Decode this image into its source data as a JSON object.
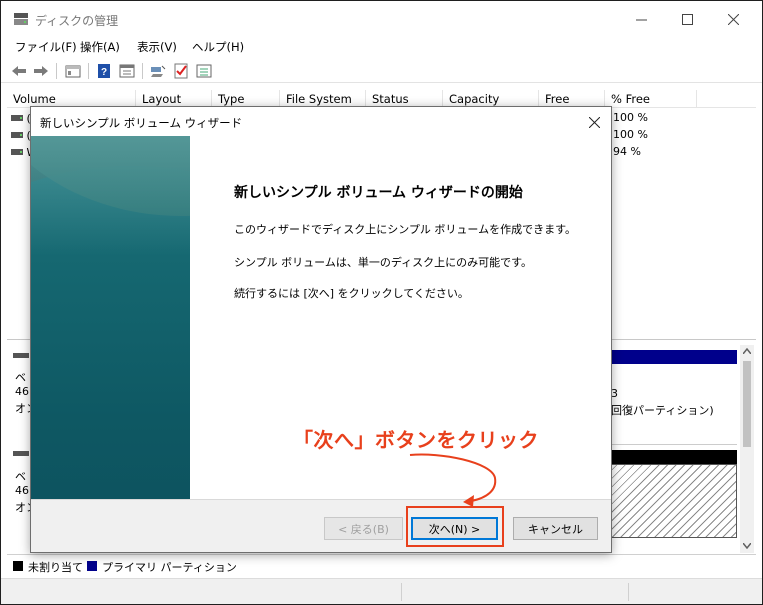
{
  "window": {
    "title": "ディスクの管理",
    "menu": [
      "ファイル(F)",
      "操作(A)",
      "表示(V)",
      "ヘルプ(H)"
    ]
  },
  "volume_list": {
    "columns": [
      "Volume",
      "Layout",
      "Type",
      "File System",
      "Status",
      "Capacity",
      "Free Spa...",
      "% Free"
    ],
    "rows": [
      {
        "volume": "(",
        "percent_free": "100 %"
      },
      {
        "volume": "(",
        "percent_free": "100 %"
      },
      {
        "volume": "W",
        "percent_free": "94 %"
      }
    ]
  },
  "disk_pane": {
    "disk0": {
      "line1": "ベ",
      "line2": "46",
      "line3": "オン"
    },
    "disk1": {
      "line1": "ベ",
      "line2": "46",
      "line3": "オン"
    },
    "partition_info": {
      "line1": "3",
      "line2": "回復パーティション)"
    }
  },
  "legend": {
    "unallocated": "未割り当て",
    "primary": "プライマリ パーティション",
    "unallocated_color": "#000000",
    "primary_color": "#00008b"
  },
  "wizard": {
    "title": "新しいシンプル ボリューム ウィザード",
    "heading": "新しいシンプル ボリューム ウィザードの開始",
    "lines": [
      "このウィザードでディスク上にシンプル ボリュームを作成できます。",
      "シンプル ボリュームは、単一のディスク上にのみ可能です。",
      "続行するには [次へ] をクリックしてください。"
    ],
    "back_button": "< 戻る(B)",
    "next_button": "次へ(N) >",
    "cancel_button": "キャンセル"
  },
  "annotation": {
    "text": "「次へ」ボタンをクリック",
    "color": "#e8401c"
  }
}
